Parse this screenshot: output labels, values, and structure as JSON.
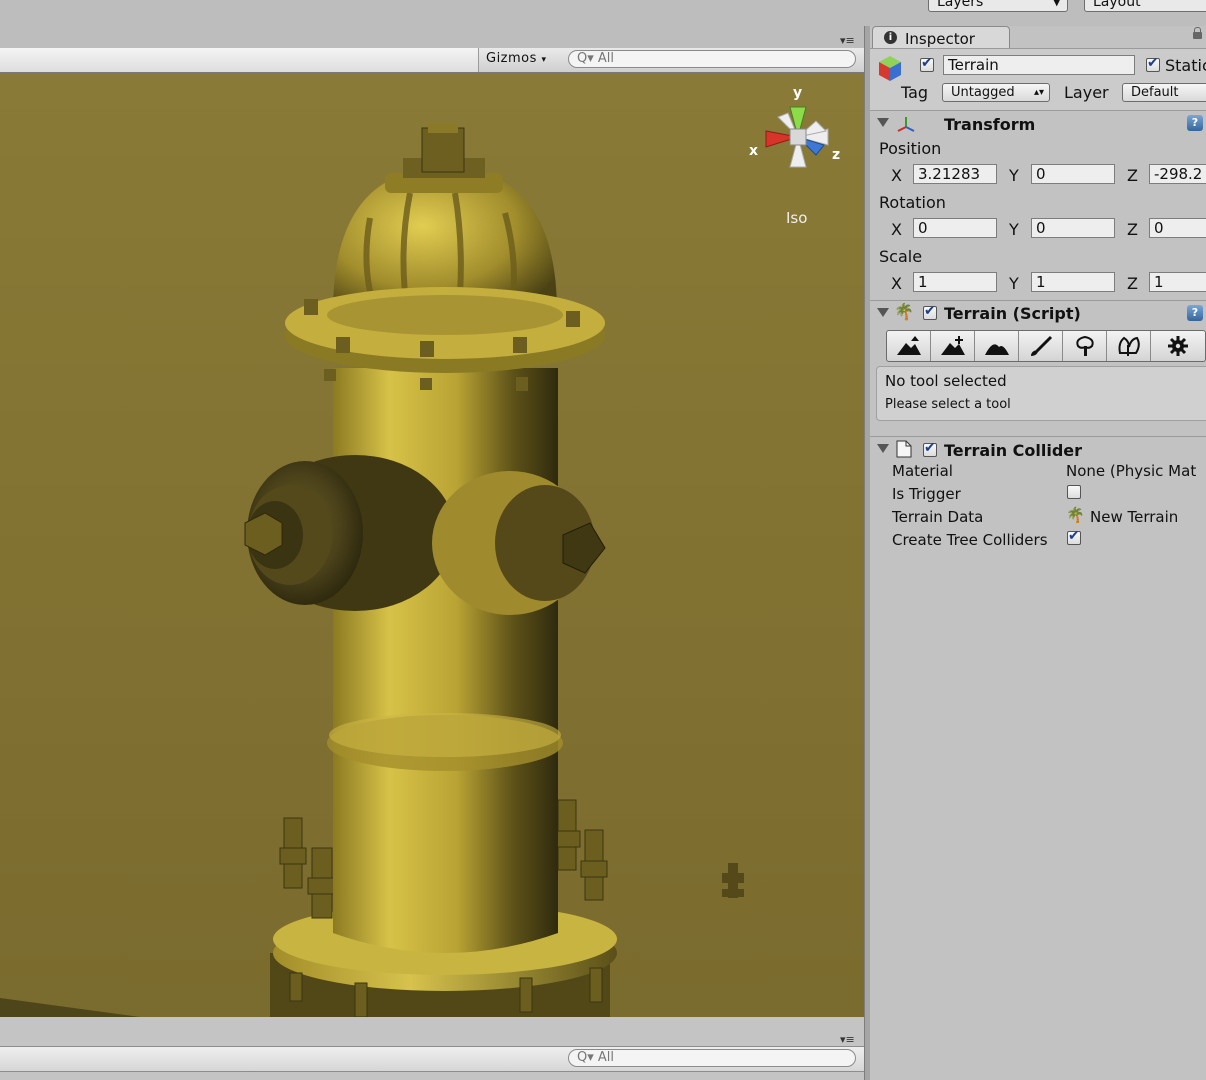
{
  "toolbar": {
    "layers_label": "Layers",
    "layout_label": "Layout"
  },
  "scene": {
    "gizmos_label": "Gizmos",
    "search_placeholder": "All",
    "view_mode": "Iso",
    "axis_x": "x",
    "axis_y": "y",
    "axis_z": "z",
    "background_color": "#857636"
  },
  "console": {
    "search_placeholder": "All"
  },
  "inspector": {
    "tab_label": "Inspector",
    "game_object": {
      "active": true,
      "name": "Terrain",
      "static_label": "Static",
      "static": true,
      "tag_label": "Tag",
      "tag_value": "Untagged",
      "layer_label": "Layer",
      "layer_value": "Default"
    },
    "transform": {
      "title": "Transform",
      "position_label": "Position",
      "rotation_label": "Rotation",
      "scale_label": "Scale",
      "x_label": "X",
      "y_label": "Y",
      "z_label": "Z",
      "position": {
        "x": "3.21283",
        "y": "0",
        "z": "-298.2"
      },
      "rotation": {
        "x": "0",
        "y": "0",
        "z": "0"
      },
      "scale": {
        "x": "1",
        "y": "1",
        "z": "1"
      }
    },
    "terrain_script": {
      "title": "Terrain (Script)",
      "enabled": true,
      "tools": [
        "raise-lower-icon",
        "paint-height-icon",
        "smooth-height-icon",
        "paint-texture-icon",
        "place-trees-icon",
        "paint-details-icon",
        "settings-icon"
      ],
      "status_title": "No tool selected",
      "status_body": "Please select a tool"
    },
    "terrain_collider": {
      "title": "Terrain Collider",
      "enabled": true,
      "material_label": "Material",
      "material_value": "None (Physic Mat",
      "is_trigger_label": "Is Trigger",
      "is_trigger": false,
      "terrain_data_label": "Terrain Data",
      "terrain_data_value": "New Terrain",
      "create_tree_colliders_label": "Create Tree Colliders",
      "create_tree_colliders": true
    }
  }
}
